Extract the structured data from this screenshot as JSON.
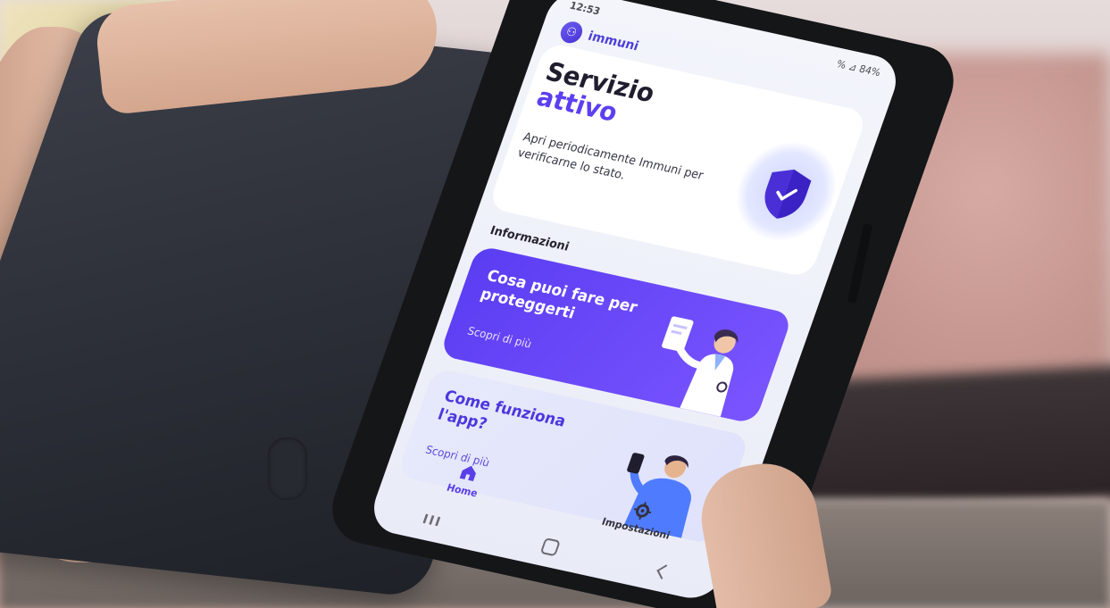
{
  "status_bar": {
    "time": "12:53",
    "indicators": "% ⊿ 84%"
  },
  "app": {
    "name": "immuni",
    "logo_icon": "immuni-logo-icon"
  },
  "hero": {
    "title_line1": "Servizio",
    "title_line2": "attivo",
    "subtitle": "Apri periodicamente Immuni per verificarne lo stato.",
    "icon": "shield-check-icon"
  },
  "section": {
    "label": "Informazioni"
  },
  "cards": [
    {
      "title": "Cosa puoi fare per proteggerti",
      "link": "Scopri di più",
      "illustration": "doctor-illustration"
    },
    {
      "title": "Come funziona l'app?",
      "link": "Scopri di più",
      "illustration": "person-phone-illustration"
    }
  ],
  "bottom_nav": {
    "home_label": "Home",
    "settings_label": "Impostazioni",
    "home_icon": "home-icon",
    "settings_icon": "gear-icon"
  },
  "system_nav": {
    "recent": "III"
  },
  "colors": {
    "accent": "#5c3ff0",
    "purple_card": "#6a48f8",
    "light_card": "#e3e6fb",
    "text_dark": "#1f1d2e"
  }
}
